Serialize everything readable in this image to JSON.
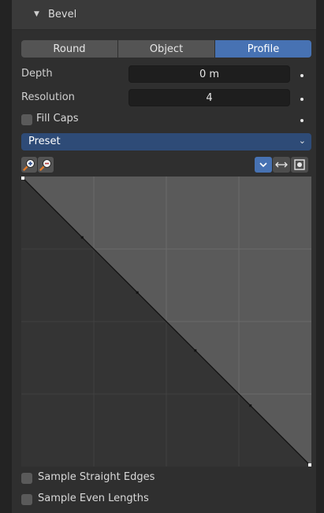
{
  "panel": {
    "title": "Bevel"
  },
  "mode_tabs": [
    {
      "label": "Round",
      "active": false
    },
    {
      "label": "Object",
      "active": false
    },
    {
      "label": "Profile",
      "active": true
    }
  ],
  "depth": {
    "label": "Depth",
    "value": "0 m"
  },
  "resolution": {
    "label": "Resolution",
    "value": "4"
  },
  "fill_caps": {
    "label": "Fill Caps",
    "checked": false
  },
  "preset": {
    "label": "Preset"
  },
  "curve_tools": {
    "zoom_in": "zoom-in-icon",
    "zoom_out": "zoom-out-icon",
    "menu": "chevron-down-icon",
    "flip": "flip-horizontal-icon",
    "clip": "clipping-icon"
  },
  "curve": {
    "points": [
      [
        0,
        1
      ],
      [
        0.21,
        0.79
      ],
      [
        0.4,
        0.6
      ],
      [
        0.6,
        0.4
      ],
      [
        0.79,
        0.21
      ],
      [
        1,
        0
      ]
    ]
  },
  "sample_straight_edges": {
    "label": "Sample Straight Edges",
    "checked": false
  },
  "sample_even_lengths": {
    "label": "Sample Even Lengths",
    "checked": false
  },
  "colors": {
    "accent": "#4772b3",
    "preset_bg": "#2e4b77"
  }
}
